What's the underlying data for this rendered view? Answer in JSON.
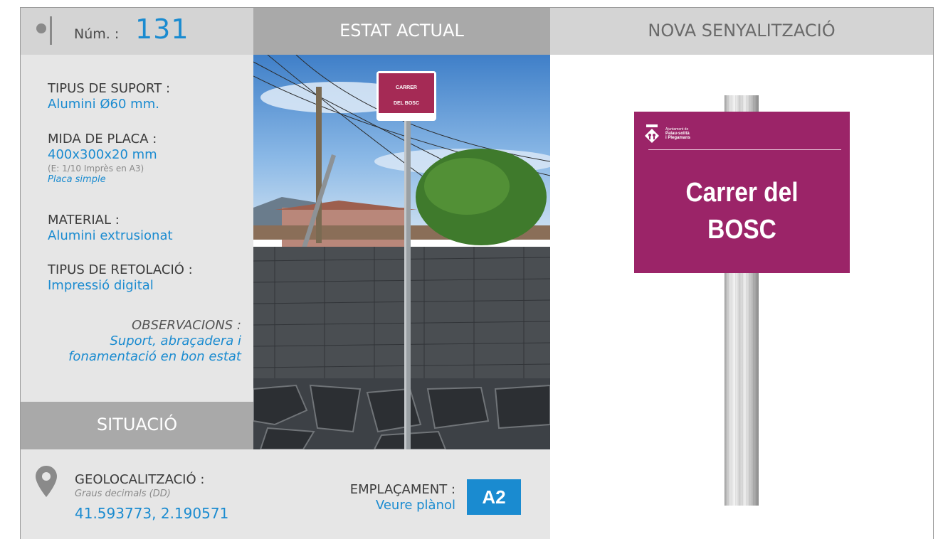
{
  "header": {
    "num_label": "Núm. :",
    "num_value": "131",
    "col_current": "ESTAT ACTUAL",
    "col_new": "NOVA SENYALITZACIÓ"
  },
  "specs": {
    "support_label": "TIPUS DE SUPORT :",
    "support_value": "Alumini Ø60 mm.",
    "size_label": "MIDA DE PLACA :",
    "size_value": "400x300x20 mm",
    "size_note": "(E: 1/10 Imprès en A3)",
    "size_type": "Placa simple",
    "material_label": "MATERIAL :",
    "material_value": "Alumini extrusionat",
    "lettering_label": "TIPUS DE RETOLACIÓ :",
    "lettering_value": "Impressió digital",
    "obs_label": "OBSERVACIONS :",
    "obs_line1": "Suport, abraçadera i",
    "obs_line2": "fonamentació en bon estat"
  },
  "situation": {
    "title": "SITUACIÓ",
    "geo_label": "GEOLOCALITZACIÓ :",
    "geo_sub": "Graus decimals (DD)",
    "geo_value": "41.593773, 2.190571",
    "placement_label": "EMPLAÇAMENT :",
    "placement_value": "Veure plànol",
    "zone": "A2"
  },
  "photo_sign": {
    "line1": "CARRER",
    "line2": "DEL BOSC"
  },
  "new_sign": {
    "org_line1": "Ajuntament de",
    "org_line2": "Palau-solità",
    "org_line3": "i Plegamans",
    "line1": "Carrer del",
    "line2": "BOSC"
  },
  "colors": {
    "accent": "#1a8bd0",
    "sign": "#9b2468"
  },
  "icons": [
    "location-pin-icon",
    "municipal-shield-icon"
  ]
}
